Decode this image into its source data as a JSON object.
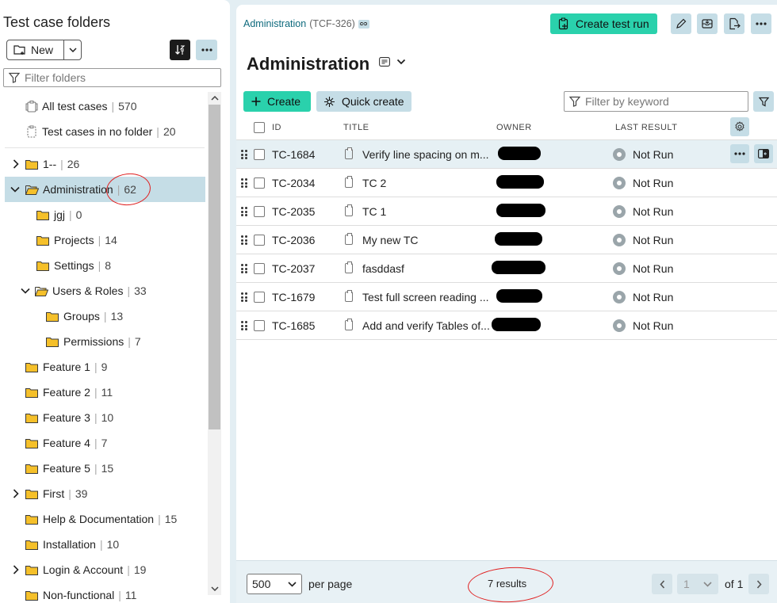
{
  "left_panel": {
    "title": "Test case folders",
    "new_label": "New",
    "filter_placeholder": "Filter folders",
    "special_items": [
      {
        "label": "All test cases",
        "count": "570"
      },
      {
        "label": "Test cases in no folder",
        "count": "20"
      }
    ],
    "folders": [
      {
        "label": "1--",
        "count": "26"
      },
      {
        "label": "Administration",
        "count": "62"
      },
      {
        "label": "jgj",
        "count": "0"
      },
      {
        "label": "Projects",
        "count": "14"
      },
      {
        "label": "Settings",
        "count": "8"
      },
      {
        "label": "Users & Roles",
        "count": "33"
      },
      {
        "label": "Groups",
        "count": "13"
      },
      {
        "label": "Permissions",
        "count": "7"
      },
      {
        "label": "Feature 1",
        "count": "9"
      },
      {
        "label": "Feature 2",
        "count": "11"
      },
      {
        "label": "Feature 3",
        "count": "10"
      },
      {
        "label": "Feature 4",
        "count": "7"
      },
      {
        "label": "Feature 5",
        "count": "15"
      },
      {
        "label": "First",
        "count": "39"
      },
      {
        "label": "Help & Documentation",
        "count": "15"
      },
      {
        "label": "Installation",
        "count": "10"
      },
      {
        "label": "Login & Account",
        "count": "19"
      },
      {
        "label": "Non-functional",
        "count": "11"
      }
    ]
  },
  "header": {
    "breadcrumb_link": "Administration",
    "breadcrumb_key": "(TCF-326)",
    "create_run_label": "Create test run",
    "page_title": "Administration"
  },
  "toolbar": {
    "create_label": "Create",
    "quick_create_label": "Quick create",
    "filter_placeholder": "Filter by keyword"
  },
  "table": {
    "columns": [
      "ID",
      "TITLE",
      "OWNER",
      "LAST RESULT"
    ],
    "rows": [
      {
        "id": "TC-1684",
        "title": "Verify line spacing on m...",
        "result": "Not Run"
      },
      {
        "id": "TC-2034",
        "title": "TC 2",
        "result": "Not Run"
      },
      {
        "id": "TC-2035",
        "title": "TC 1",
        "result": "Not Run"
      },
      {
        "id": "TC-2036",
        "title": "My new TC",
        "result": "Not Run"
      },
      {
        "id": "TC-2037",
        "title": "fasddasf",
        "result": "Not Run"
      },
      {
        "id": "TC-1679",
        "title": "Test full screen reading ...",
        "result": "Not Run"
      },
      {
        "id": "TC-1685",
        "title": "Add and verify Tables of...",
        "result": "Not Run"
      }
    ]
  },
  "footer": {
    "per_page_value": "500",
    "per_page_label": "per page",
    "results_text": "7 results",
    "current_page": "1",
    "of_label": "of 1"
  },
  "colors": {
    "accent_green": "#2ad1ac",
    "accent_blue": "#c5dde6",
    "annotation_red": "#e02020",
    "link": "#0e6a7d"
  }
}
